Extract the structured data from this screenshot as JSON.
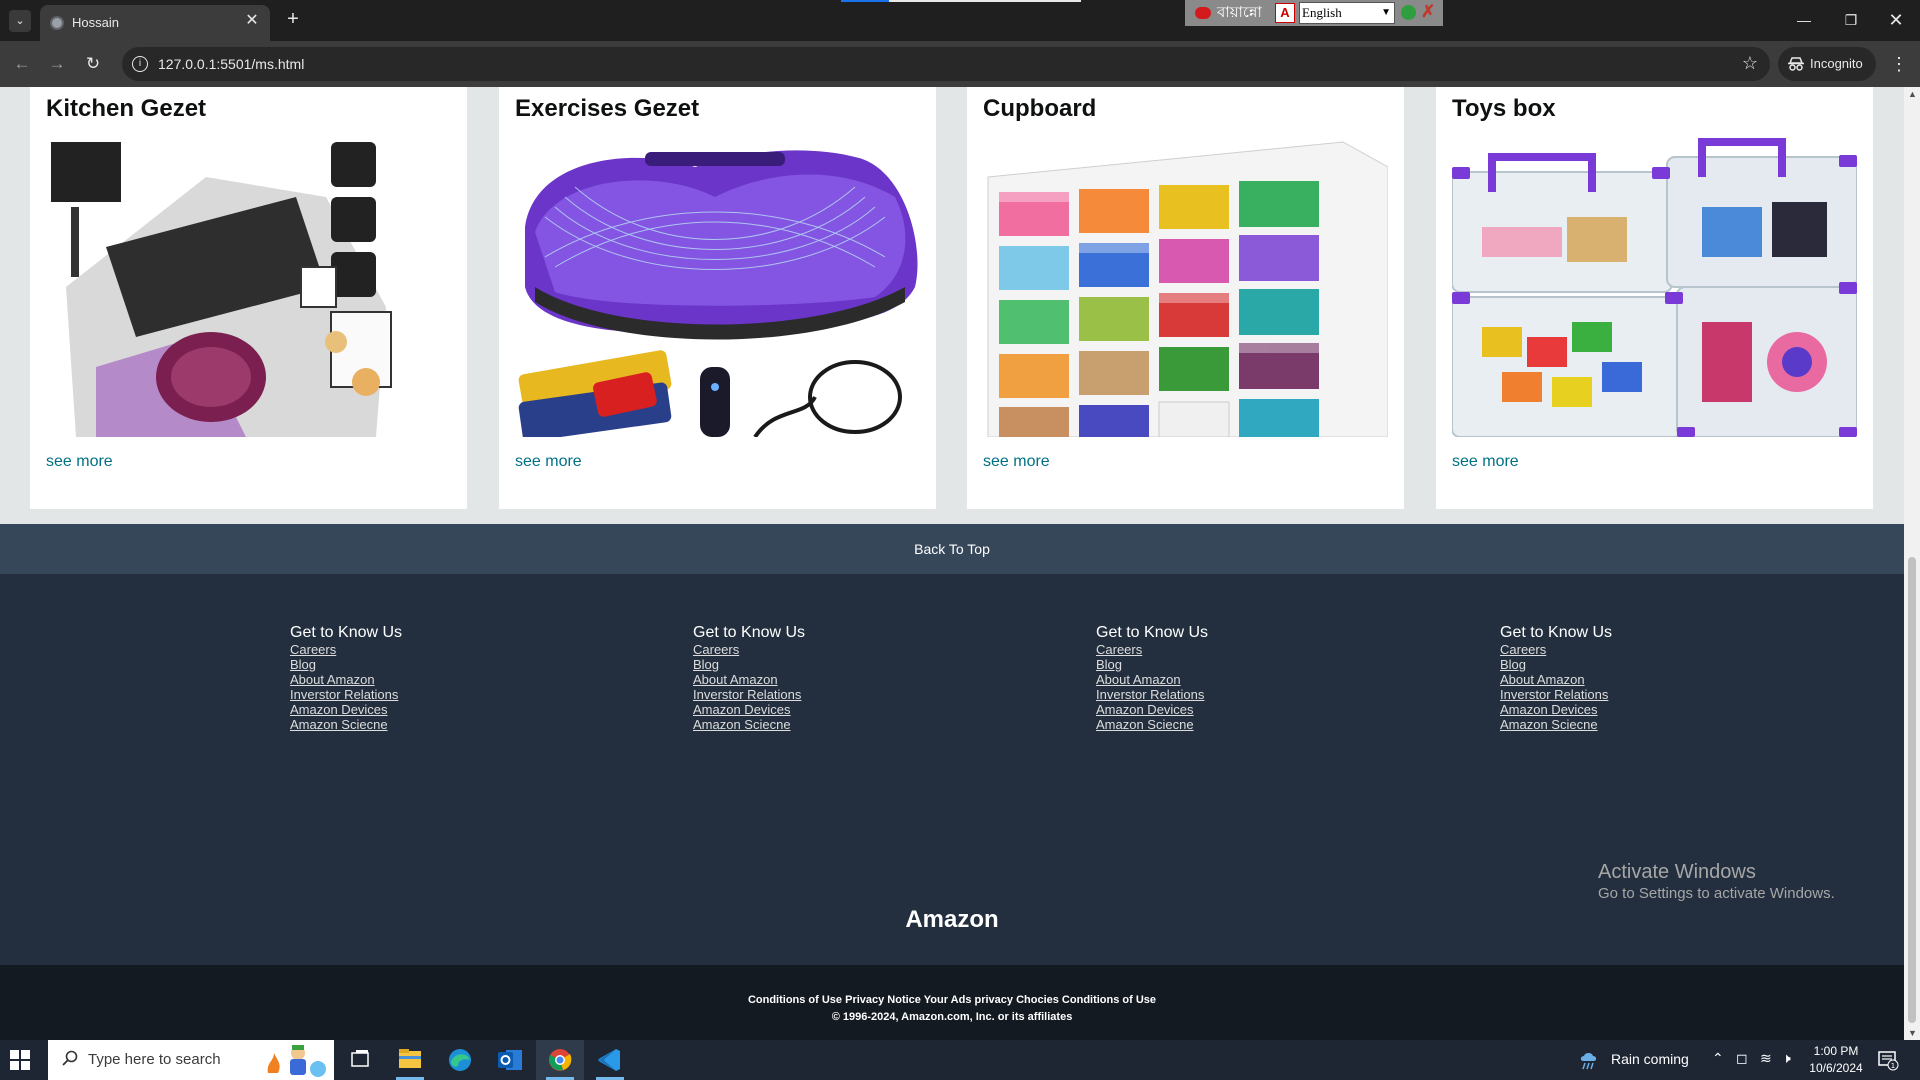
{
  "browser": {
    "tab_title": "Hossain",
    "url": "127.0.0.1:5501/ms.html",
    "incognito_label": "Incognito",
    "keyboard_lang_label": "বায়ান্নো",
    "keyboard_lang_select": "English"
  },
  "cards": [
    {
      "title": "Kitchen Gezet",
      "link": "see more",
      "image": "kitchen-gadget-image"
    },
    {
      "title": "Exercises Gezet",
      "link": "see more",
      "image": "exercise-gadget-image"
    },
    {
      "title": "Cupboard",
      "link": "see more",
      "image": "cupboard-image"
    },
    {
      "title": "Toys box",
      "link": "see more",
      "image": "toys-box-image"
    }
  ],
  "footer": {
    "back_to_top": "Back To Top",
    "columns": [
      {
        "heading": "Get to Know Us",
        "links": [
          "Careers",
          "Blog",
          "About Amazon",
          "Inverstor Relations",
          "Amazon Devices",
          "Amazon Sciecne"
        ]
      },
      {
        "heading": "Get to Know Us",
        "links": [
          "Careers",
          "Blog",
          "About Amazon",
          "Inverstor Relations",
          "Amazon Devices",
          "Amazon Sciecne"
        ]
      },
      {
        "heading": "Get to Know Us",
        "links": [
          "Careers",
          "Blog",
          "About Amazon",
          "Inverstor Relations",
          "Amazon Devices",
          "Amazon Sciecne"
        ]
      },
      {
        "heading": "Get to Know Us",
        "links": [
          "Careers",
          "Blog",
          "About Amazon",
          "Inverstor Relations",
          "Amazon Devices",
          "Amazon Sciecne"
        ]
      }
    ],
    "brand": "Amazon",
    "conditions": "Conditions of Use Privacy Notice Your Ads privacy Chocies Conditions of Use",
    "copyright": "© 1996-2024, Amazon.com, Inc. or its affiliates"
  },
  "watermark": {
    "title": "Activate Windows",
    "subtitle": "Go to Settings to activate Windows."
  },
  "taskbar": {
    "search_placeholder": "Type here to search",
    "weather": "Rain coming",
    "time": "1:00 PM",
    "date": "10/6/2024",
    "notification_count": "1"
  },
  "colors": {
    "link": "#007185",
    "back_to_top_bg": "#37475a",
    "footer_bg": "#232f3e",
    "footer_bottom_bg": "#131a22"
  }
}
